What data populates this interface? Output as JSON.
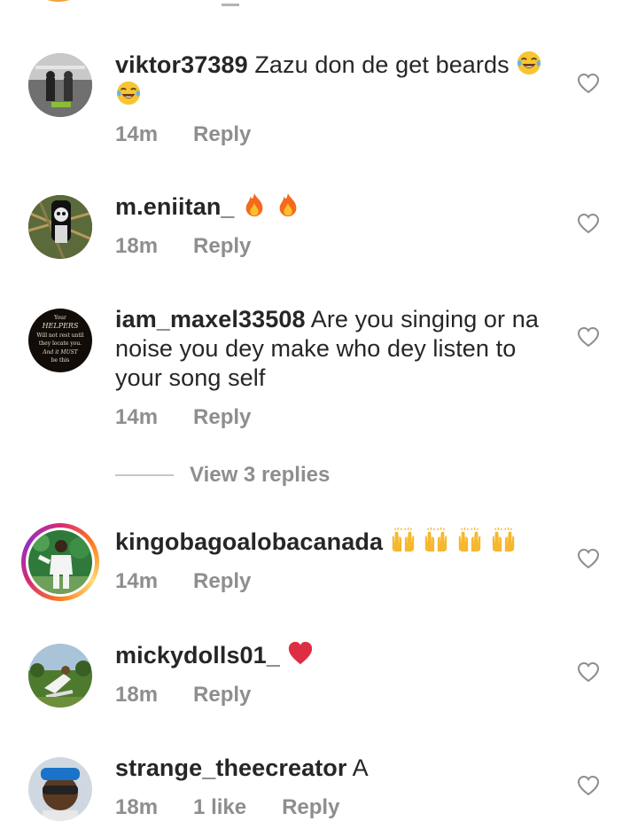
{
  "comments": [
    {
      "username": "viktor37389",
      "text": "Zazu don de get beards",
      "time": "14m",
      "reply_label": "Reply",
      "emojis": [
        "laughing-tears",
        "laughing-tears"
      ]
    },
    {
      "username": "m.eniitan_",
      "text": "",
      "time": "18m",
      "reply_label": "Reply",
      "emojis": [
        "fire",
        "fire"
      ]
    },
    {
      "username": "iam_maxel33508",
      "text": "Are you singing or na noise you dey make who dey listen to your song self",
      "time": "14m",
      "reply_label": "Reply",
      "avatar_text": {
        "l1": "Your",
        "l2": "HELPERS",
        "l3": "Will not rest until",
        "l4": "they locate you.",
        "l5": "And it MUST",
        "l6": "be this"
      }
    },
    {
      "username": "kingobagoalobacanada",
      "text": "",
      "time": "14m",
      "reply_label": "Reply",
      "emojis": [
        "raised-hands",
        "raised-hands",
        "raised-hands",
        "raised-hands"
      ]
    },
    {
      "username": "mickydolls01_",
      "text": "",
      "time": "18m",
      "reply_label": "Reply",
      "emojis": [
        "red-heart"
      ]
    },
    {
      "username": "strange_theecreator",
      "text": "A",
      "time": "18m",
      "likes": "1 like",
      "reply_label": "Reply"
    }
  ],
  "view_replies": "View 3 replies",
  "colors": {
    "primary_text": "#262626",
    "secondary_text": "#8e8e8e",
    "divider": "#c7c7c7",
    "heart_outline": "#8e8e8e"
  }
}
